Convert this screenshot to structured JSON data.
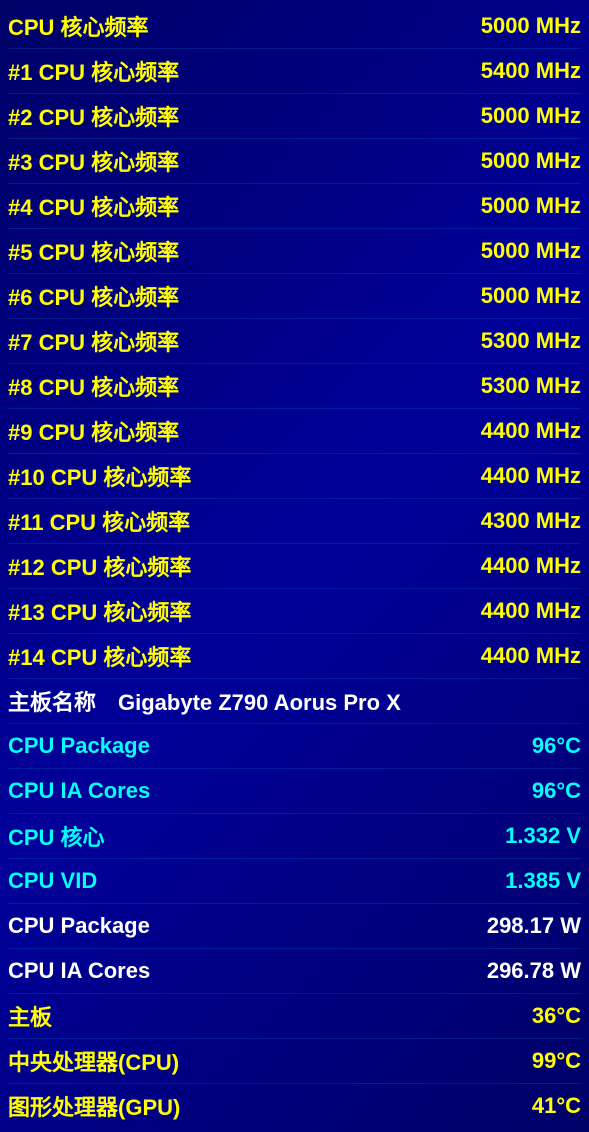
{
  "rows": [
    {
      "label": "CPU 核心频率",
      "value": "5000 MHz",
      "labelColor": "yellow",
      "valueColor": "yellow"
    },
    {
      "label": "#1 CPU 核心频率",
      "value": "5400 MHz",
      "labelColor": "yellow",
      "valueColor": "yellow"
    },
    {
      "label": "#2 CPU 核心频率",
      "value": "5000 MHz",
      "labelColor": "yellow",
      "valueColor": "yellow"
    },
    {
      "label": "#3 CPU 核心频率",
      "value": "5000 MHz",
      "labelColor": "yellow",
      "valueColor": "yellow"
    },
    {
      "label": "#4 CPU 核心频率",
      "value": "5000 MHz",
      "labelColor": "yellow",
      "valueColor": "yellow"
    },
    {
      "label": "#5 CPU 核心频率",
      "value": "5000 MHz",
      "labelColor": "yellow",
      "valueColor": "yellow"
    },
    {
      "label": "#6 CPU 核心频率",
      "value": "5000 MHz",
      "labelColor": "yellow",
      "valueColor": "yellow"
    },
    {
      "label": "#7 CPU 核心频率",
      "value": "5300 MHz",
      "labelColor": "yellow",
      "valueColor": "yellow"
    },
    {
      "label": "#8 CPU 核心频率",
      "value": "5300 MHz",
      "labelColor": "yellow",
      "valueColor": "yellow"
    },
    {
      "label": "#9 CPU 核心频率",
      "value": "4400 MHz",
      "labelColor": "yellow",
      "valueColor": "yellow"
    },
    {
      "label": "#10 CPU 核心频率",
      "value": "4400 MHz",
      "labelColor": "yellow",
      "valueColor": "yellow"
    },
    {
      "label": "#11 CPU 核心频率",
      "value": "4300 MHz",
      "labelColor": "yellow",
      "valueColor": "yellow"
    },
    {
      "label": "#12 CPU 核心频率",
      "value": "4400 MHz",
      "labelColor": "yellow",
      "valueColor": "yellow"
    },
    {
      "label": "#13 CPU 核心频率",
      "value": "4400 MHz",
      "labelColor": "yellow",
      "valueColor": "yellow"
    },
    {
      "label": "#14 CPU 核心频率",
      "value": "4400 MHz",
      "labelColor": "yellow",
      "valueColor": "yellow"
    },
    {
      "label": "主板名称　Gigabyte Z790 Aorus Pro X",
      "value": "",
      "labelColor": "white",
      "valueColor": "white"
    },
    {
      "label": "CPU Package",
      "value": "96°C",
      "labelColor": "cyan",
      "valueColor": "cyan"
    },
    {
      "label": "CPU IA Cores",
      "value": "96°C",
      "labelColor": "cyan",
      "valueColor": "cyan"
    },
    {
      "label": "CPU 核心",
      "value": "1.332 V",
      "labelColor": "cyan",
      "valueColor": "cyan"
    },
    {
      "label": "CPU VID",
      "value": "1.385 V",
      "labelColor": "cyan",
      "valueColor": "cyan"
    },
    {
      "label": "CPU Package",
      "value": "298.17 W",
      "labelColor": "white",
      "valueColor": "white"
    },
    {
      "label": "CPU IA Cores",
      "value": "296.78 W",
      "labelColor": "white",
      "valueColor": "white"
    },
    {
      "label": "主板",
      "value": "36°C",
      "labelColor": "yellow",
      "valueColor": "yellow"
    },
    {
      "label": "中央处理器(CPU)",
      "value": "99°C",
      "labelColor": "yellow",
      "valueColor": "yellow"
    },
    {
      "label": "图形处理器(GPU)",
      "value": "41°C",
      "labelColor": "yellow",
      "valueColor": "yellow"
    }
  ]
}
